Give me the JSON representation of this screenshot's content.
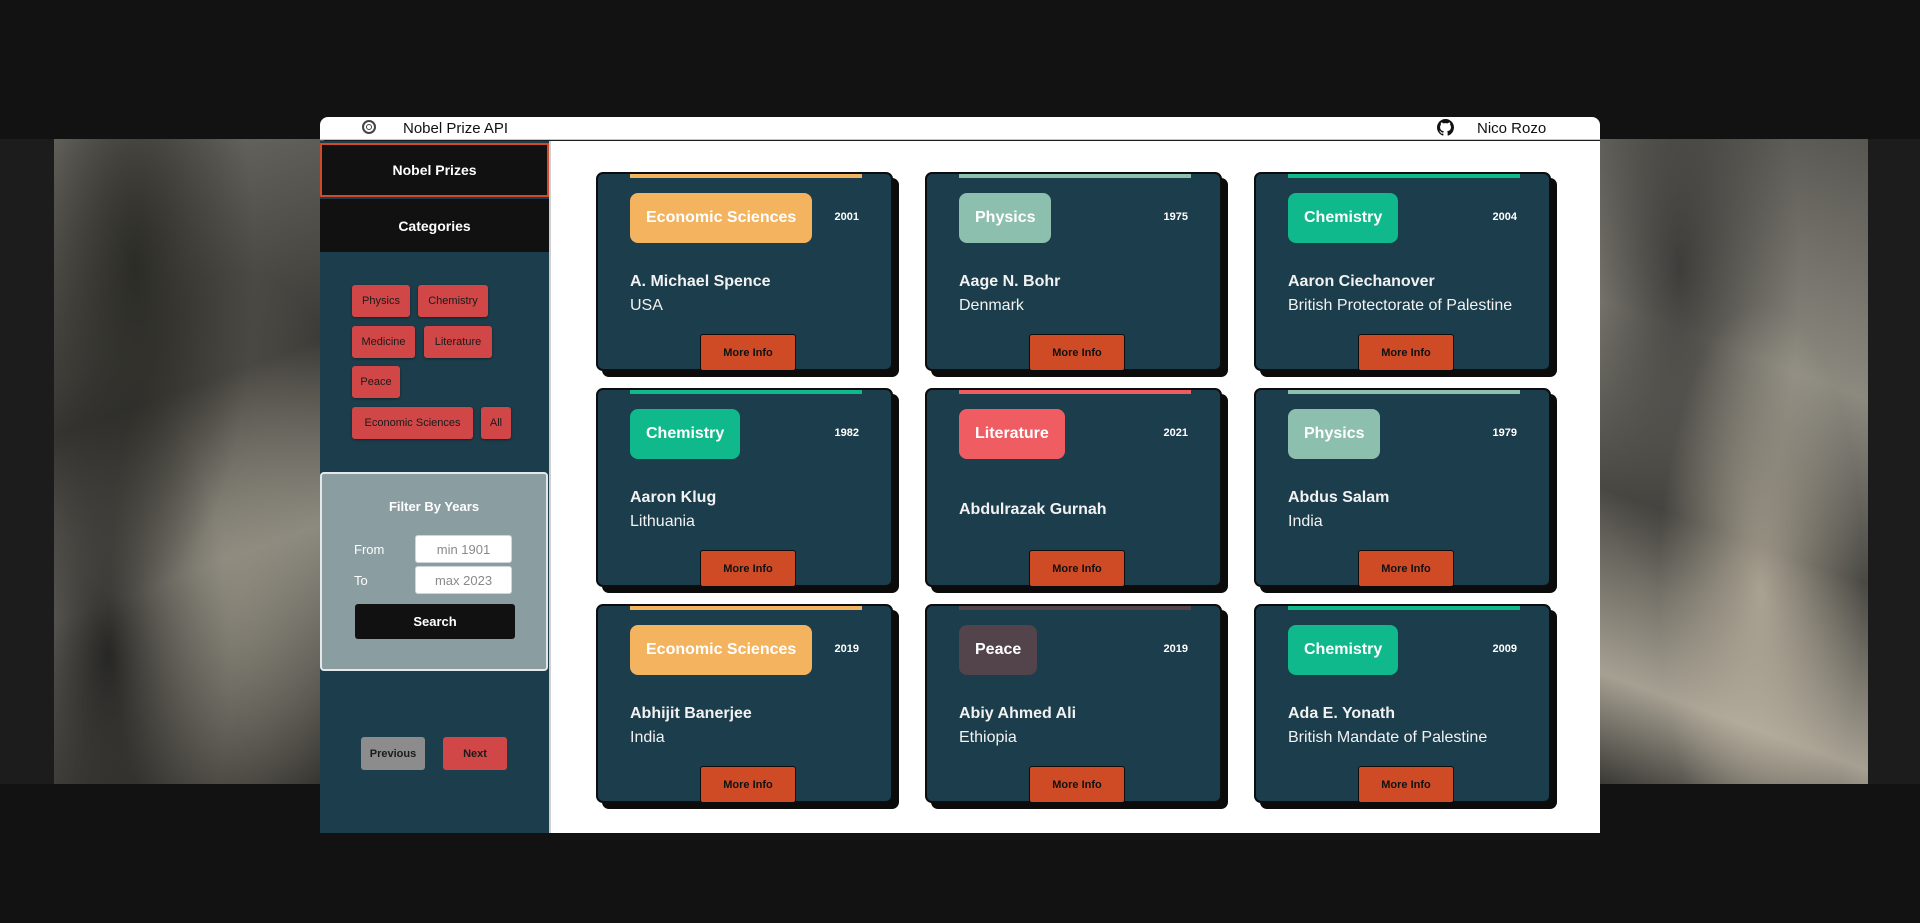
{
  "header": {
    "app_name": "Nobel Prize API",
    "author": "Nico Rozo"
  },
  "sidebar": {
    "nav": [
      {
        "label": "Nobel Prizes"
      },
      {
        "label": "Categories"
      }
    ],
    "categories": [
      {
        "label": "Physics"
      },
      {
        "label": "Chemistry"
      },
      {
        "label": "Medicine"
      },
      {
        "label": "Literature"
      },
      {
        "label": "Peace"
      },
      {
        "label": "Economic Sciences"
      },
      {
        "label": "All"
      }
    ],
    "filter": {
      "title": "Filter By Years",
      "from_label": "From",
      "from_placeholder": "min 1901",
      "to_label": "To",
      "to_placeholder": "max 2023",
      "search_label": "Search"
    },
    "pager": {
      "previous_label": "Previous",
      "next_label": "Next"
    }
  },
  "colors": {
    "Economic Sciences": "#f4b35e",
    "Physics": "#8dbfae",
    "Chemistry": "#10b98b",
    "Literature": "#ef5d62",
    "Peace": "#53434a",
    "accent": "#cf4b26"
  },
  "cards": [
    {
      "category": "Economic Sciences",
      "year": "2001",
      "name": "A. Michael Spence",
      "country": "USA",
      "button": "More Info"
    },
    {
      "category": "Physics",
      "year": "1975",
      "name": "Aage N. Bohr",
      "country": "Denmark",
      "button": "More Info"
    },
    {
      "category": "Chemistry",
      "year": "2004",
      "name": "Aaron Ciechanover",
      "country": "British Protectorate of Palestine",
      "button": "More Info"
    },
    {
      "category": "Chemistry",
      "year": "1982",
      "name": "Aaron Klug",
      "country": "Lithuania",
      "button": "More Info"
    },
    {
      "category": "Literature",
      "year": "2021",
      "name": "Abdulrazak Gurnah",
      "country": "",
      "button": "More Info"
    },
    {
      "category": "Physics",
      "year": "1979",
      "name": "Abdus Salam",
      "country": "India",
      "button": "More Info"
    },
    {
      "category": "Economic Sciences",
      "year": "2019",
      "name": "Abhijit Banerjee",
      "country": "India",
      "button": "More Info"
    },
    {
      "category": "Peace",
      "year": "2019",
      "name": "Abiy Ahmed Ali",
      "country": "Ethiopia",
      "button": "More Info"
    },
    {
      "category": "Chemistry",
      "year": "2009",
      "name": "Ada E. Yonath",
      "country": "British Mandate of Palestine",
      "button": "More Info"
    }
  ]
}
